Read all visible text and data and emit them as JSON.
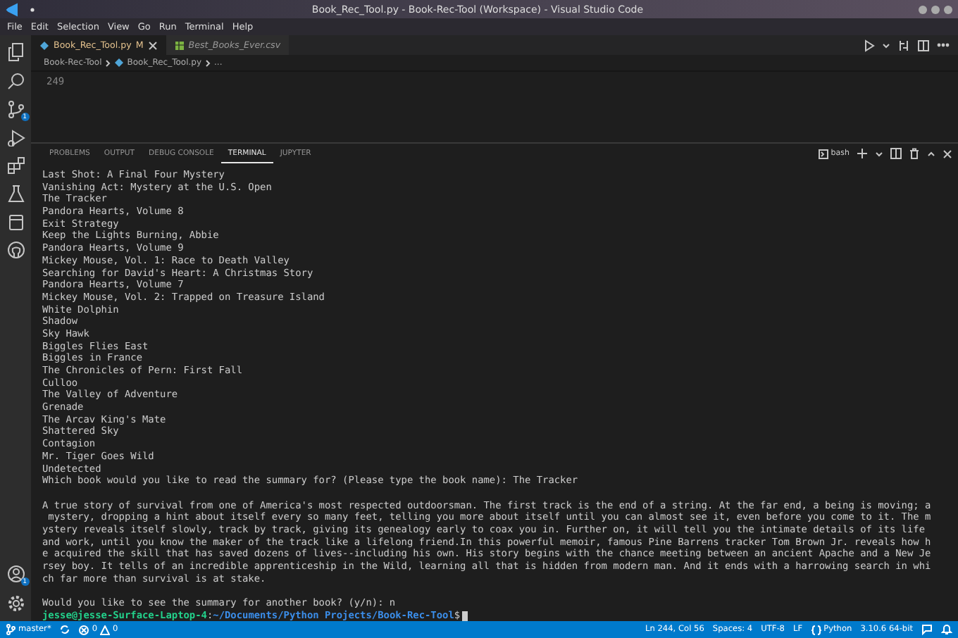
{
  "window": {
    "title": "Book_Rec_Tool.py - Book-Rec-Tool (Workspace) - Visual Studio Code"
  },
  "menu": [
    "File",
    "Edit",
    "Selection",
    "View",
    "Go",
    "Run",
    "Terminal",
    "Help"
  ],
  "activity_bar": {
    "source_control_badge": "1",
    "accounts_badge": "1"
  },
  "editor_tabs": [
    {
      "label": "Book_Rec_Tool.py",
      "kind": "python",
      "status": "M",
      "selected": true,
      "preview": false
    },
    {
      "label": "Best_Books_Ever.csv",
      "kind": "csv",
      "selected": false,
      "preview": true
    }
  ],
  "breadcrumb": [
    "Book-Rec-Tool",
    "Book_Rec_Tool.py",
    "..."
  ],
  "editor": {
    "line_number": "249"
  },
  "panel_tabs": [
    {
      "label": "PROBLEMS",
      "selected": false
    },
    {
      "label": "OUTPUT",
      "selected": false
    },
    {
      "label": "DEBUG CONSOLE",
      "selected": false
    },
    {
      "label": "TERMINAL",
      "selected": true
    },
    {
      "label": "JUPYTER",
      "selected": false
    }
  ],
  "terminal": {
    "shell": "bash",
    "sections": [
      [
        "Last Shot: A Final Four Mystery",
        "Vanishing Act: Mystery at the U.S. Open",
        "The Tracker",
        "Pandora Hearts, Volume 8",
        "Exit Strategy",
        "Keep the Lights Burning, Abbie",
        "Pandora Hearts, Volume 9",
        "Mickey Mouse, Vol. 1: Race to Death Valley",
        "Searching for David's Heart: A Christmas Story",
        "Pandora Hearts, Volume 7",
        "Mickey Mouse, Vol. 2: Trapped on Treasure Island",
        "White Dolphin",
        "Shadow",
        "Sky Hawk",
        "Biggles Flies East",
        "Biggles in France",
        "The Chronicles of Pern: First Fall",
        "Culloo",
        "The Valley of Adventure",
        "Grenade",
        "The Arcav King's Mate",
        "Shattered Sky",
        "Contagion",
        "Mr. Tiger Goes Wild",
        "Undetected",
        "Which book would you like to read the summary for? (Please type the book name): The Tracker"
      ],
      [
        "A true story of survival from one of America's most respected outdoorsman. The first track is the end of a string. At the far end, a being is moving; a",
        " mystery, dropping a hint about itself every so many feet, telling you more about itself until you can almost see it, even before you come to it. The m",
        "ystery reveals itself slowly, track by track, giving its genealogy early to coax you in. Further on, it will tell you the intimate details of its life",
        "and work, until you know the maker of the track like a lifelong friend.In this powerful memoir, famous Pine Barrens tracker Tom Brown Jr. reveals how h",
        "e acquired the skill that has saved dozens of lives--including his own. His story begins with the chance meeting between an ancient Apache and a New Je",
        "rsey boy. It tells of an incredible apprenticeship in the Wild, learning all that is hidden from modern man. And it ends with a harrowing search in whi",
        "ch far more than survival is at stake."
      ],
      [
        "Would you like to see the summary for another book? (y/n): n"
      ]
    ],
    "prompt": {
      "user_host": "jesse@jesse-Surface-Laptop-4",
      "separator": ":",
      "path": "~/Documents/Python Projects/Book-Rec-Tool",
      "symbol": "$"
    }
  },
  "status_bar": {
    "branch": "master*",
    "errors": "0",
    "warnings": "0",
    "items": [
      "Ln 244, Col 56",
      "Spaces: 4",
      "UTF-8",
      "LF",
      "Python",
      "3.10.6 64-bit"
    ]
  }
}
